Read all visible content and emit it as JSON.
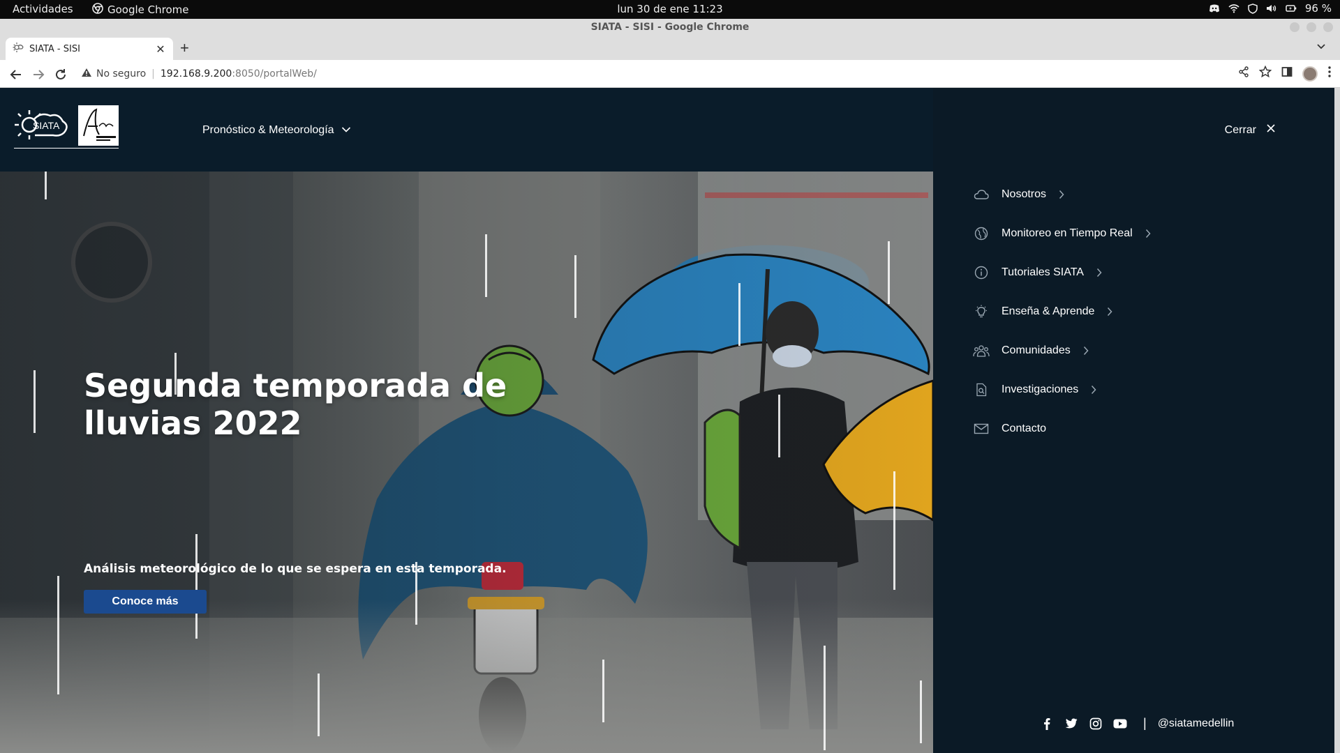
{
  "os_bar": {
    "activities": "Actividades",
    "app_name": "Google Chrome",
    "clock": "lun 30 de ene  11:23",
    "battery": "96 %"
  },
  "browser": {
    "window_title": "SIATA - SISI - Google Chrome",
    "tab_title": "SIATA - SISI",
    "security_label": "No seguro",
    "url_host": "192.168.9.200",
    "url_path": ":8050/portalWeb/"
  },
  "site": {
    "main_nav_label": "Pronóstico & Meteorología",
    "hero": {
      "title": "Segunda temporada de lluvias 2022",
      "subtitle": "Análisis meteorológico de lo que se espera en esta temporada.",
      "button": "Conoce más"
    },
    "side_menu": {
      "close_label": "Cerrar",
      "items": [
        {
          "label": "Nosotros",
          "icon": "cloud-icon",
          "has_submenu": true
        },
        {
          "label": "Monitoreo en Tiempo Real",
          "icon": "globe-icon",
          "has_submenu": true
        },
        {
          "label": "Tutoriales SIATA",
          "icon": "info-icon",
          "has_submenu": true
        },
        {
          "label": "Enseña & Aprende",
          "icon": "lightbulb-icon",
          "has_submenu": true
        },
        {
          "label": "Comunidades",
          "icon": "people-icon",
          "has_submenu": true
        },
        {
          "label": "Investigaciones",
          "icon": "document-search-icon",
          "has_submenu": true
        },
        {
          "label": "Contacto",
          "icon": "envelope-icon",
          "has_submenu": false
        }
      ],
      "social_handle": "@siatamedellin",
      "social_icons": [
        "facebook-icon",
        "twitter-icon",
        "instagram-icon",
        "youtube-icon"
      ]
    }
  },
  "colors": {
    "page_bg": "#0a1c2a",
    "menu_bg": "#0b1a26",
    "button_bg": "#1b4a8f",
    "umbrella_blue": "#2a82be",
    "umbrella_yellow": "#e0a41e",
    "helmet_green": "#6aa83a"
  }
}
